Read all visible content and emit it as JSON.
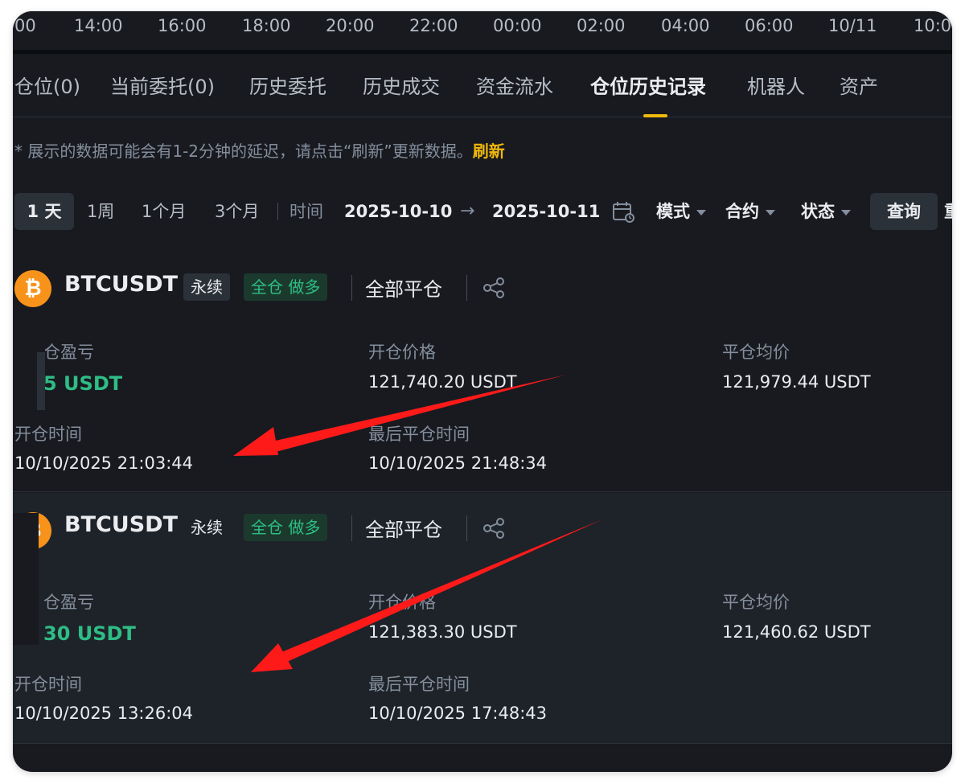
{
  "time_axis": [
    "00",
    "14:00",
    "16:00",
    "18:00",
    "20:00",
    "22:00",
    "00:00",
    "02:00",
    "04:00",
    "06:00",
    "10/11",
    "10:0"
  ],
  "tabs": [
    {
      "label": "仓位(0)",
      "active": false
    },
    {
      "label": "当前委托(0)",
      "active": false
    },
    {
      "label": "历史委托",
      "active": false
    },
    {
      "label": "历史成交",
      "active": false
    },
    {
      "label": "资金流水",
      "active": false
    },
    {
      "label": "仓位历史记录",
      "active": true
    },
    {
      "label": "机器人",
      "active": false
    },
    {
      "label": "资产",
      "active": false
    }
  ],
  "notice": {
    "text": "* 展示的数据可能会有1-2分钟的延迟，请点击“刷新”更新数据。",
    "refresh_label": "刷新"
  },
  "filters": {
    "ranges": [
      "1 天",
      "1周",
      "1个月",
      "3个月"
    ],
    "active_range": "1 天",
    "time_label": "时间",
    "start_date": "2025-10-10",
    "arrow": "→",
    "end_date": "2025-10-11",
    "mode_label": "模式",
    "contract_label": "合约",
    "status_label": "状态",
    "query_label": "查询",
    "reset_label": "重"
  },
  "positions": [
    {
      "symbol": "BTCUSDT",
      "perp_tag": "永续",
      "mode_tag": "全仓 做多",
      "close_all": "全部平仓",
      "pnl_label": "仓盈亏",
      "pnl_value": "5 USDT",
      "open_price_label": "开仓价格",
      "open_price": "121,740.20 USDT",
      "close_avg_label": "平仓均价",
      "close_avg": "121,979.44 USDT",
      "open_time_label": "开仓时间",
      "open_time": "10/10/2025 21:03:44",
      "last_close_label": "最后平仓时间",
      "last_close": "10/10/2025 21:48:34"
    },
    {
      "symbol": "BTCUSDT",
      "perp_tag": "永续",
      "mode_tag": "全仓 做多",
      "close_all": "全部平仓",
      "pnl_label": "仓盈亏",
      "pnl_value": "30 USDT",
      "open_price_label": "开仓价格",
      "open_price": "121,383.30 USDT",
      "close_avg_label": "平仓均价",
      "close_avg": "121,460.62 USDT",
      "open_time_label": "开仓时间",
      "open_time": "10/10/2025 13:26:04",
      "last_close_label": "最后平仓时间",
      "last_close": "10/10/2025 17:48:43"
    }
  ],
  "colors": {
    "background": "#181a20",
    "card_alt": "#1e2329",
    "accent": "#f0b90b",
    "profit": "#2ebd85",
    "annotation_arrow": "#ff1a1a",
    "btc": "#f7931a"
  },
  "icons": {
    "coin": "bitcoin-icon",
    "share": "share-icon",
    "calendar": "calendar-icon",
    "annotation": "red-arrow-annotation"
  }
}
